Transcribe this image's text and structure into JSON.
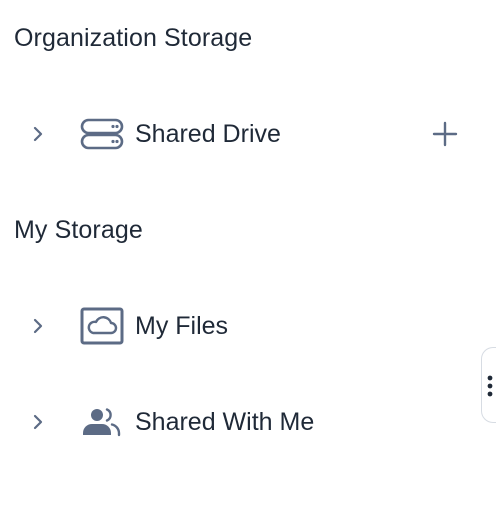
{
  "sections": {
    "organization": {
      "title": "Organization Storage",
      "items": [
        {
          "label": "Shared Drive",
          "icon": "server-icon",
          "action_icon": "plus-icon"
        }
      ]
    },
    "my_storage": {
      "title": "My Storage",
      "items": [
        {
          "label": "My Files",
          "icon": "cloud-folder-icon"
        },
        {
          "label": "Shared With Me",
          "icon": "users-icon"
        }
      ]
    }
  },
  "colors": {
    "text": "#1f2937",
    "icon": "#5c6b85",
    "handle_border": "#d7dce3"
  }
}
